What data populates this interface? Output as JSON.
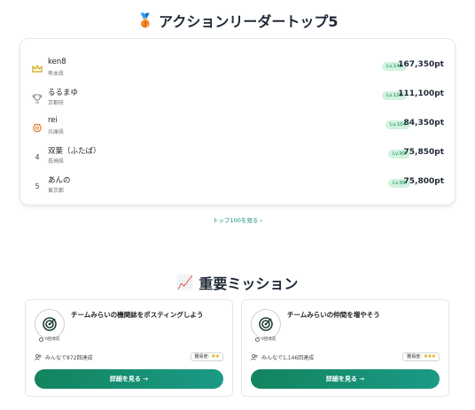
{
  "leaderboard": {
    "title": "アクションリーダートップ5",
    "emoji": "🥉",
    "rows": [
      {
        "rank": "",
        "rank_icon": "crown-icon",
        "name": "ken8",
        "prefecture": "熊本県",
        "level": "Lv.148",
        "points": "167,350pt"
      },
      {
        "rank": "",
        "rank_icon": "trophy-icon",
        "name": "るるまゆ",
        "prefecture": "京都府",
        "level": "Lv.120",
        "points": "111,100pt"
      },
      {
        "rank": "",
        "rank_icon": "medal-icon",
        "name": "rei",
        "prefecture": "兵庫県",
        "level": "Lv.104",
        "points": "84,350pt"
      },
      {
        "rank": "4",
        "rank_icon": "",
        "name": "双葉（ふたば）",
        "prefecture": "長崎県",
        "level": "Lv.99",
        "points": "75,850pt"
      },
      {
        "rank": "5",
        "rank_icon": "",
        "name": "あんの",
        "prefecture": "東京都",
        "level": "Lv.99",
        "points": "75,800pt"
      }
    ],
    "more_link": "トップ100を見る ›"
  },
  "missions": {
    "title": "重要ミッション",
    "emoji": "📈",
    "cards": [
      {
        "title": "チームみらいの機関誌をポスティングしよう",
        "done": "0回達成",
        "count": "みんなで872回達成",
        "difficulty_label": "難易度:",
        "stars": "★★",
        "button": "詳細を見る →"
      },
      {
        "title": "チームみらいの仲間を増やそう",
        "done": "0回達成",
        "count": "みんなで1,146回達成",
        "difficulty_label": "難易度:",
        "stars": "★★★",
        "button": "詳細を見る →"
      }
    ]
  },
  "colors": {
    "accent": "#128c6a",
    "level_bg": "#d1f2df",
    "level_text": "#178a58",
    "link": "#178a7a"
  }
}
